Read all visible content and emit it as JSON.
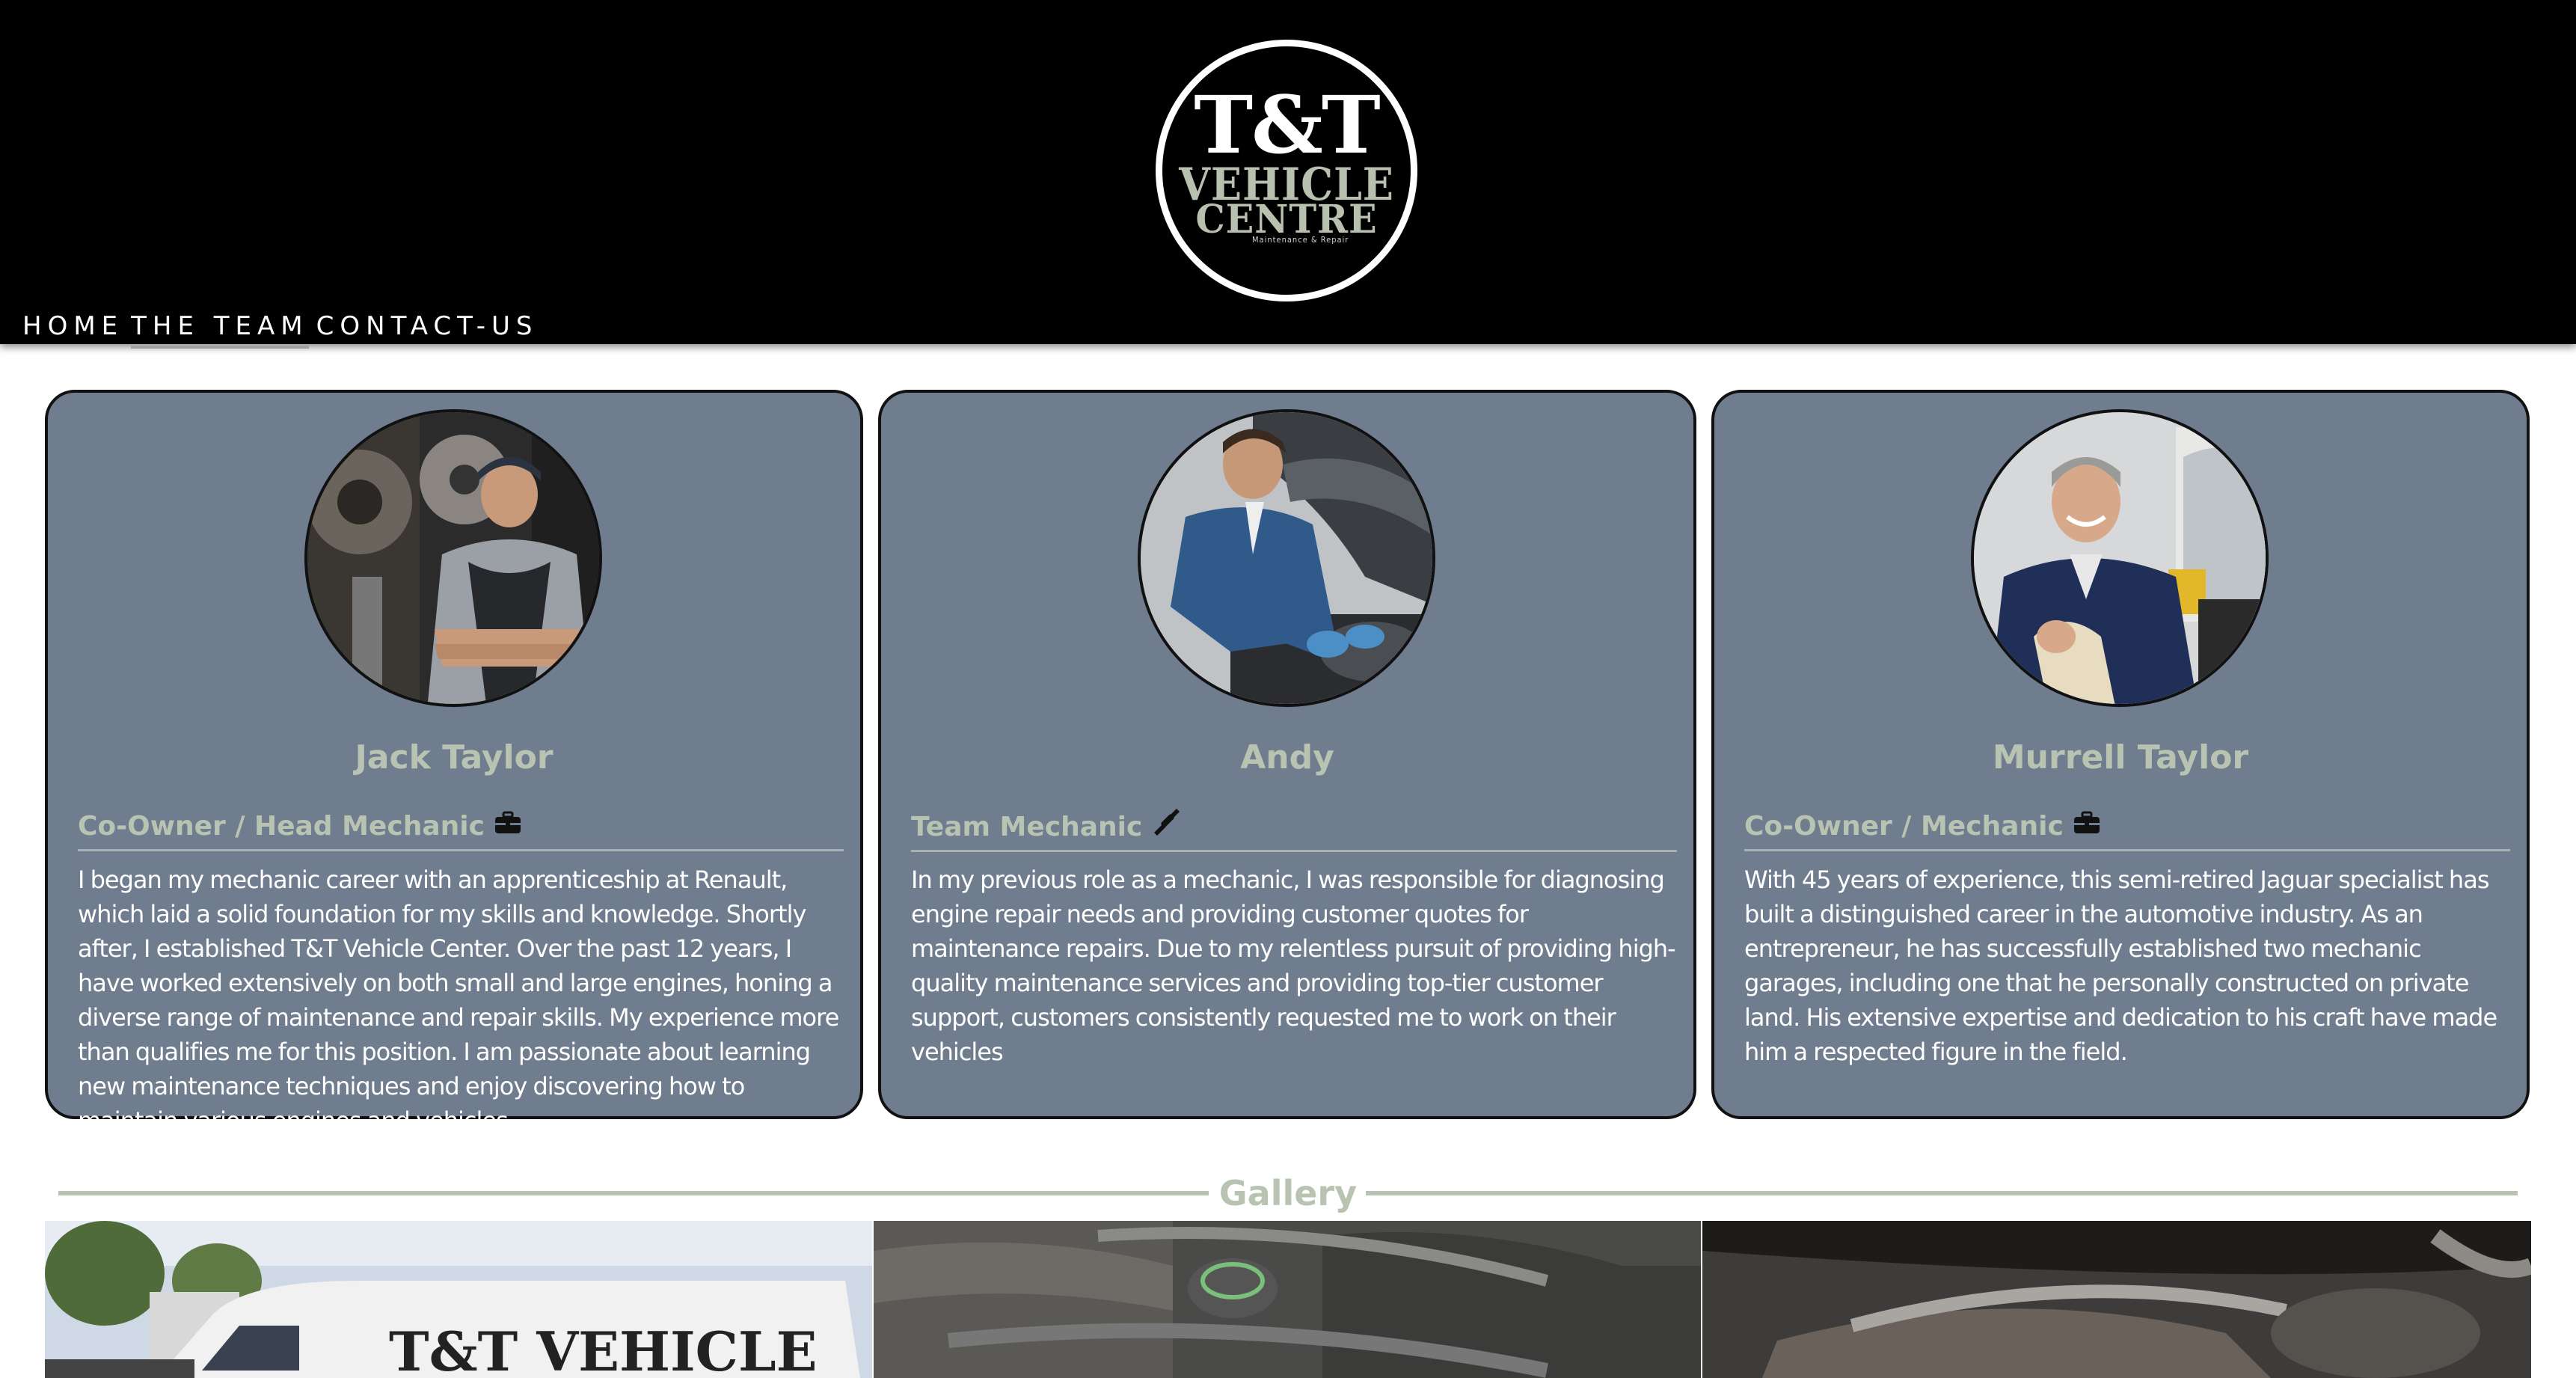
{
  "header": {
    "logo": {
      "line_tt": "T&T",
      "line_vehicle": "VEHICLE",
      "line_centre": "CENTRE",
      "tagline": "Maintenance & Repair"
    },
    "nav": [
      {
        "label": "HOME",
        "active": false
      },
      {
        "label": "THE TEAM",
        "active": true
      },
      {
        "label": "CONTACT-US",
        "active": false
      }
    ]
  },
  "team": [
    {
      "name": "Jack Taylor",
      "role": "Co-Owner / Head Mechanic",
      "role_icon": "toolbox-icon",
      "bio": "I began my mechanic career with an apprenticeship at Renault, which laid a solid foundation for my skills and knowledge. Shortly after, I established T&T Vehicle Center. Over the past 12 years, I have worked extensively on both small and large engines, honing a diverse range of maintenance and repair skills. My experience more than qualifies me for this position. I am passionate about learning new maintenance techniques and enjoy discovering how to maintain various engines and vehicles.",
      "photo": "mechanic-arms-crossed-photo"
    },
    {
      "name": "Andy",
      "role": "Team Mechanic",
      "role_icon": "screwdriver-icon",
      "bio": "In my previous role as a mechanic, I was responsible for diagnosing engine repair needs and providing customer quotes for maintenance repairs. Due to my relentless pursuit of providing high-quality maintenance services and providing top-tier customer support, customers consistently requested me to work on their vehicles",
      "photo": "mechanic-working-engine-photo"
    },
    {
      "name": "Murrell Taylor",
      "role": "Co-Owner / Mechanic",
      "role_icon": "toolbox-icon",
      "bio": "With 45 years of experience, this semi-retired Jaguar specialist has built a distinguished career in the automotive industry. As an entrepreneur, he has successfully established two mechanic garages, including one that he personally constructed on private land. His extensive expertise and dedication to his craft have made him a respected figure in the field.",
      "photo": "senior-mechanic-rag-photo"
    }
  ],
  "gallery": {
    "title": "Gallery",
    "images": [
      {
        "name": "van-photo",
        "caption": "T&T VEHICLE"
      },
      {
        "name": "engine-bay-photo",
        "caption": ""
      },
      {
        "name": "undercarriage-photo",
        "caption": ""
      }
    ]
  },
  "colors": {
    "header_bg": "#000000",
    "card_bg": "#6f7d8f",
    "accent_sage": "#b9c3b2",
    "text_white": "#ffffff"
  }
}
